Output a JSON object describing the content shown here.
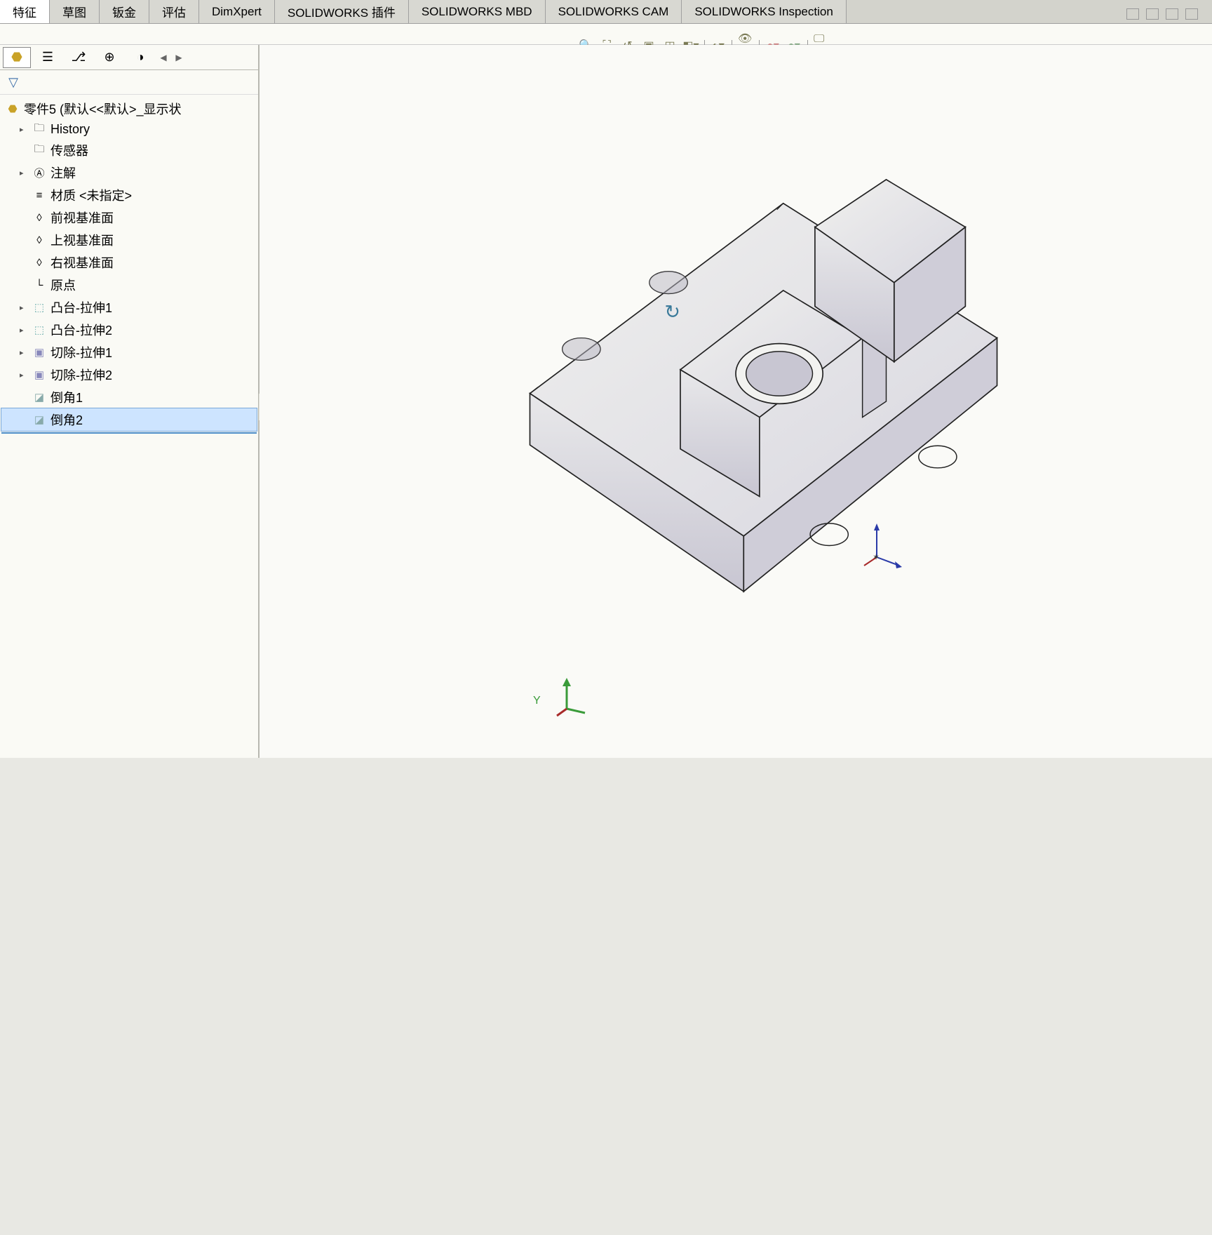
{
  "tabs": {
    "items": [
      {
        "label": "特征",
        "active": true
      },
      {
        "label": "草图",
        "active": false
      },
      {
        "label": "钣金",
        "active": false
      },
      {
        "label": "评估",
        "active": false
      },
      {
        "label": "DimXpert",
        "active": false
      },
      {
        "label": "SOLIDWORKS 插件",
        "active": false
      },
      {
        "label": "SOLIDWORKS MBD",
        "active": false
      },
      {
        "label": "SOLIDWORKS CAM",
        "active": false
      },
      {
        "label": "SOLIDWORKS Inspection",
        "active": false
      }
    ]
  },
  "hud": {
    "icons": [
      "zoom-fit",
      "zoom-area",
      "prev-view",
      "section",
      "display-style",
      "scene",
      "edge",
      "coord",
      "appearance",
      "render",
      "screen"
    ]
  },
  "tree": {
    "root": "零件5  (默认<<默认>_显示状",
    "items": [
      {
        "label": "History",
        "icon": "folder",
        "expandable": true
      },
      {
        "label": "传感器",
        "icon": "sensor",
        "expandable": false
      },
      {
        "label": "注解",
        "icon": "annotation",
        "expandable": true
      },
      {
        "label": "材质 <未指定>",
        "icon": "material",
        "expandable": false
      },
      {
        "label": "前视基准面",
        "icon": "plane",
        "expandable": false
      },
      {
        "label": "上视基准面",
        "icon": "plane",
        "expandable": false
      },
      {
        "label": "右视基准面",
        "icon": "plane",
        "expandable": false
      },
      {
        "label": "原点",
        "icon": "origin",
        "expandable": false
      },
      {
        "label": "凸台-拉伸1",
        "icon": "extrude",
        "expandable": true
      },
      {
        "label": "凸台-拉伸2",
        "icon": "extrude",
        "expandable": true
      },
      {
        "label": "切除-拉伸1",
        "icon": "cut",
        "expandable": true
      },
      {
        "label": "切除-拉伸2",
        "icon": "cut",
        "expandable": true
      },
      {
        "label": "倒角1",
        "icon": "chamfer",
        "expandable": false
      },
      {
        "label": "倒角2",
        "icon": "chamfer",
        "expandable": false,
        "selected": true
      }
    ]
  },
  "axis": {
    "y_label": "Y"
  }
}
